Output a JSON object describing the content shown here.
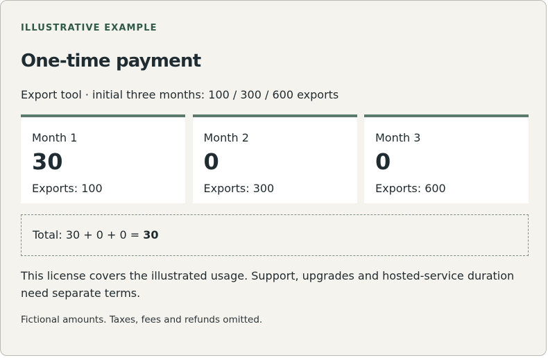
{
  "eyebrow": "ILLUSTRATIVE EXAMPLE",
  "title": "One-time payment",
  "subtitle": "Export tool · initial three months: 100 / 300 / 600 exports",
  "months": [
    {
      "label": "Month 1",
      "value": "30",
      "exports": "Exports: 100"
    },
    {
      "label": "Month 2",
      "value": "0",
      "exports": "Exports: 300"
    },
    {
      "label": "Month 3",
      "value": "0",
      "exports": "Exports: 600"
    }
  ],
  "total": {
    "prefix": "Total: 30 + 0 + 0 = ",
    "result": "30"
  },
  "note": "This license covers the illustrated usage. Support, upgrades and hosted-service duration need separate terms.",
  "footnote": "Fictional amounts. Taxes, fees and refunds omitted.",
  "colors": {
    "background": "#f5f3ee",
    "accent": "#5a7a6c",
    "eyebrow": "#2f5a4a",
    "text": "#1f2a2e"
  }
}
